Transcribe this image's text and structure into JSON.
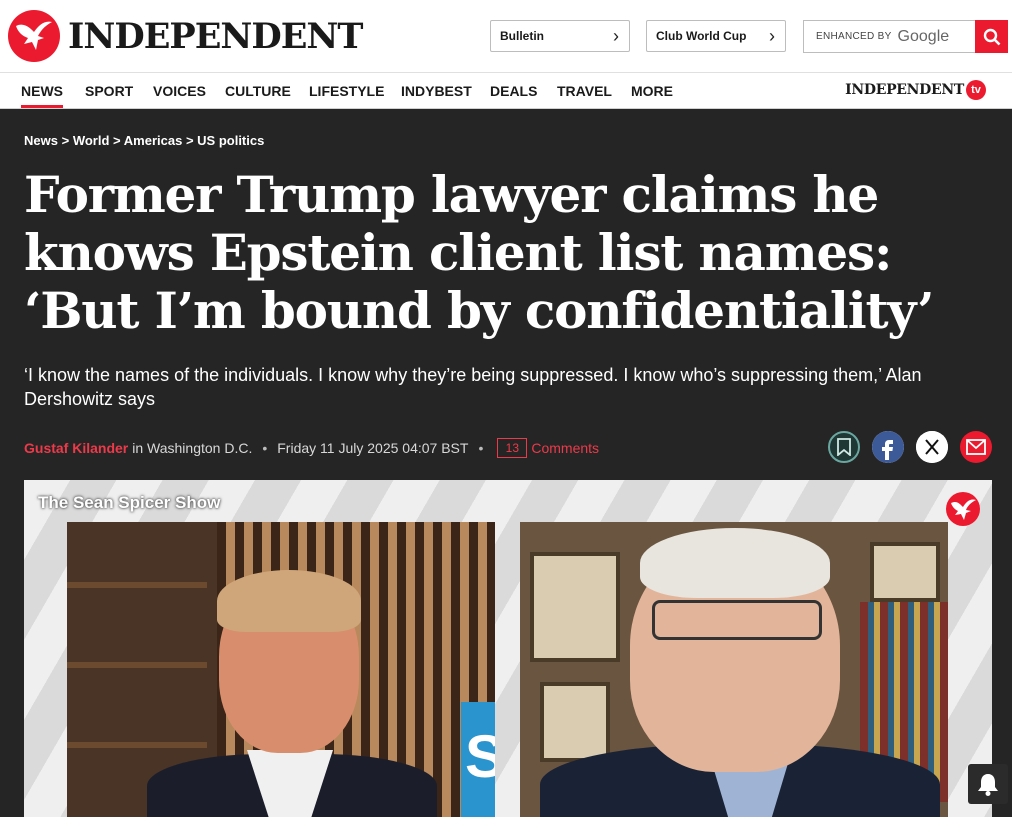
{
  "site": {
    "logo_text": "INDEPENDENT",
    "brand_color": "#ec1a2e"
  },
  "header": {
    "promos": [
      {
        "label": "Bulletin"
      },
      {
        "label": "Club World Cup"
      }
    ],
    "search": {
      "enhanced_by": "ENHANCED BY",
      "provider": "Google",
      "icon": "search-icon"
    }
  },
  "nav": {
    "items": [
      "NEWS",
      "SPORT",
      "VOICES",
      "CULTURE",
      "LIFESTYLE",
      "INDYBEST",
      "DEALS",
      "TRAVEL",
      "MORE"
    ],
    "active": "NEWS",
    "tv_logo_text": "INDEPENDENT",
    "tv_badge": "tv"
  },
  "article": {
    "breadcrumb": [
      "News",
      "World",
      "Americas",
      "US politics"
    ],
    "breadcrumb_separator": ">",
    "headline": "Former Trump lawyer claims he knows Epstein client list names: ‘But I’m bound by confidentiality’",
    "standfirst": "‘I know the names of the individuals. I know why they’re being suppressed. I know who’s suppressing them,’ Alan Dershowitz says",
    "author": "Gustaf Kilander",
    "location": "in Washington D.C.",
    "date": "Friday 11 July 2025 04:07 BST",
    "comment_count": "13",
    "comments_label": "Comments",
    "share_icons": [
      "bookmark-icon",
      "facebook-icon",
      "x-icon",
      "email-icon"
    ]
  },
  "video": {
    "show_title": "The Sean Spicer Show"
  },
  "notifications": {
    "icon": "bell-icon"
  }
}
